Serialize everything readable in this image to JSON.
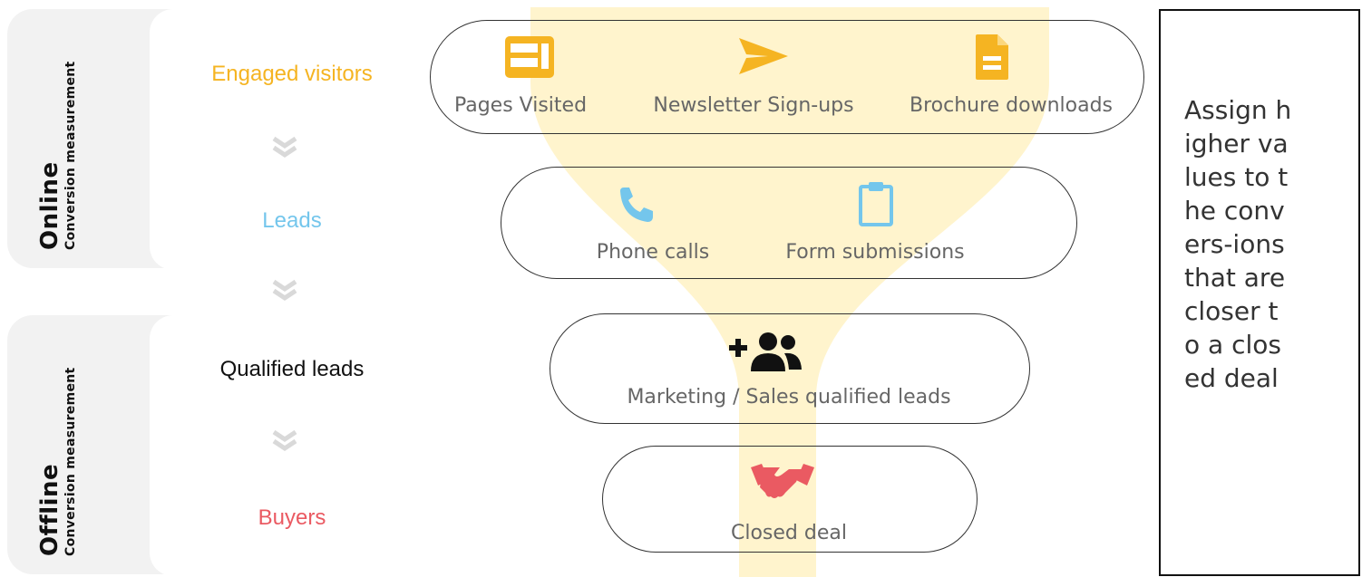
{
  "sections": {
    "online": {
      "title": "Online",
      "subtitle": "Conversion measurement"
    },
    "offline": {
      "title": "Offline",
      "subtitle": "Conversion measurement"
    }
  },
  "stages": {
    "engaged": {
      "label": "Engaged visitors",
      "color": "#f5b422"
    },
    "leads": {
      "label": "Leads",
      "color": "#74c6ec"
    },
    "qualified": {
      "label": "Qualified leads",
      "color": "#111111"
    },
    "buyers": {
      "label": "Buyers",
      "color": "#ea5a62"
    }
  },
  "pills": {
    "engaged": [
      {
        "label": "Pages Visited",
        "icon": "layout-icon"
      },
      {
        "label": "Newsletter Sign-ups",
        "icon": "send-icon"
      },
      {
        "label": "Brochure downloads",
        "icon": "document-icon"
      }
    ],
    "leads": [
      {
        "label": "Phone calls",
        "icon": "phone-icon"
      },
      {
        "label": "Form submissions",
        "icon": "clipboard-icon"
      }
    ],
    "qualified": [
      {
        "label": "Marketing / Sales qualified leads",
        "icon": "add-group-icon"
      }
    ],
    "buyers": [
      {
        "label": "Closed deal",
        "icon": "handshake-icon"
      }
    ]
  },
  "note": {
    "text": "Assign higher values to the convers-ions that are closer to a closed deal"
  },
  "colors": {
    "panel": "#f2f2f2",
    "funnel": "#fff3c8",
    "chevron": "#d9d9d9",
    "icon_yellow": "#f5b422",
    "icon_blue": "#74c6ec",
    "icon_red": "#ea5a62"
  }
}
